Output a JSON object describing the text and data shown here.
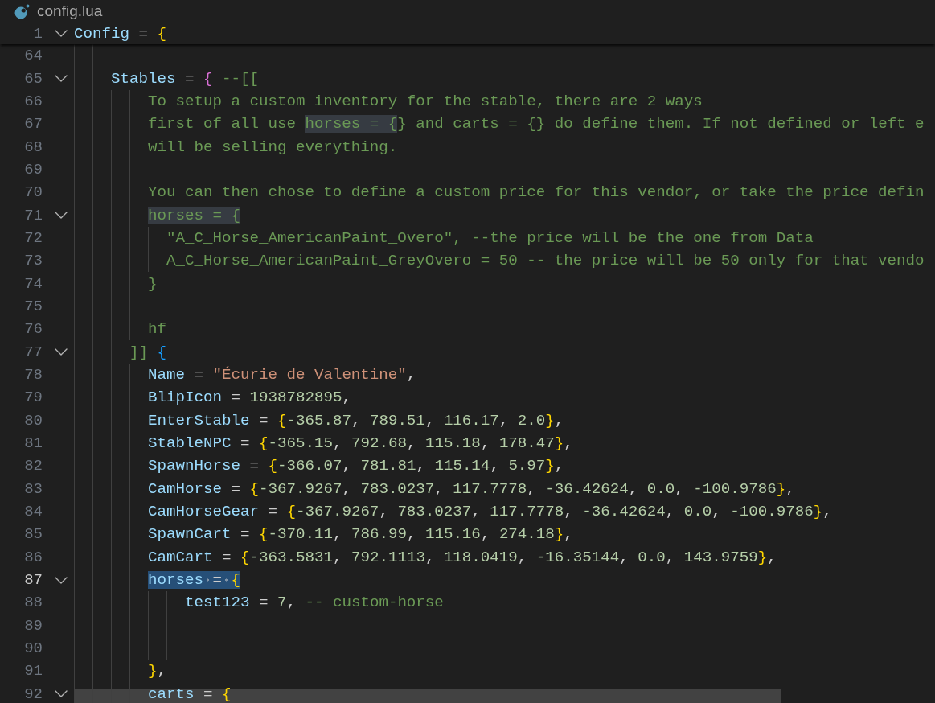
{
  "breadcrumb": {
    "file": "config.lua"
  },
  "sticky_scroll": [
    {
      "number": "1",
      "fold": {
        "expanded": true
      },
      "current": false,
      "tokens": [
        {
          "kind": "variable",
          "text": "Config"
        },
        {
          "kind": "plain",
          "text": " = "
        },
        {
          "kind": "bracket",
          "text": "{",
          "color": "#ffd700"
        }
      ]
    }
  ],
  "lines": [
    {
      "number": "64",
      "current": false
    },
    {
      "number": "65",
      "fold": {
        "expanded": true
      },
      "current": false,
      "tokens": [
        {
          "kind": "variable",
          "text": "    Stables"
        },
        {
          "kind": "plain",
          "text": " = "
        },
        {
          "kind": "bracket",
          "text": "{",
          "color": "#da70d6"
        },
        {
          "kind": "comment",
          "text": " --[["
        }
      ]
    },
    {
      "number": "66",
      "current": false,
      "tokens": [
        {
          "kind": "comment",
          "text": "        To setup a custom inventory for the stable, there are 2 ways"
        }
      ]
    },
    {
      "number": "67",
      "current": false,
      "tokens": [
        {
          "kind": "comment",
          "text": "        first of all use "
        },
        {
          "kind": "comment",
          "text": "horses = {",
          "highlighted": true
        },
        {
          "kind": "comment",
          "text": "} and carts = {} do define them. If not defined or left e"
        }
      ]
    },
    {
      "number": "68",
      "current": false,
      "tokens": [
        {
          "kind": "comment",
          "text": "        will be selling everything."
        }
      ]
    },
    {
      "number": "69",
      "current": false
    },
    {
      "number": "70",
      "current": false,
      "tokens": [
        {
          "kind": "comment",
          "text": "        You can then chose to define a custom price for this vendor, or take the price defin"
        }
      ]
    },
    {
      "number": "71",
      "fold": {
        "expanded": true
      },
      "current": false,
      "tokens": [
        {
          "kind": "comment",
          "text": "        horses = {",
          "highlighted": true
        }
      ]
    },
    {
      "number": "72",
      "current": false,
      "tokens": [
        {
          "kind": "comment",
          "text": "          \"A_C_Horse_AmericanPaint_Overo\", --the price will be the one from Data"
        }
      ]
    },
    {
      "number": "73",
      "current": false,
      "tokens": [
        {
          "kind": "comment",
          "text": "          A_C_Horse_AmericanPaint_GreyOvero = 50 -- the price will be 50 only for that vendo"
        }
      ]
    },
    {
      "number": "74",
      "current": false,
      "tokens": [
        {
          "kind": "comment",
          "text": "        }"
        }
      ]
    },
    {
      "number": "75",
      "current": false
    },
    {
      "number": "76",
      "current": false,
      "tokens": [
        {
          "kind": "comment",
          "text": "        hf"
        }
      ]
    },
    {
      "number": "77",
      "fold": {
        "expanded": true
      },
      "current": false,
      "tokens": [
        {
          "kind": "comment",
          "text": "      ]] "
        },
        {
          "kind": "bracket",
          "text": "{",
          "color": "#179fff"
        }
      ]
    },
    {
      "number": "78",
      "current": false,
      "tokens": [
        {
          "kind": "variable",
          "text": "        Name"
        },
        {
          "kind": "plain",
          "text": " = "
        },
        {
          "kind": "string",
          "text": "\"Écurie de Valentine\""
        },
        {
          "kind": "plain",
          "text": ","
        }
      ]
    },
    {
      "number": "79",
      "current": false,
      "tokens": [
        {
          "kind": "variable",
          "text": "        BlipIcon"
        },
        {
          "kind": "plain",
          "text": " = "
        },
        {
          "kind": "number",
          "text": "1938782895"
        },
        {
          "kind": "plain",
          "text": ","
        }
      ]
    },
    {
      "number": "80",
      "current": false,
      "tokens": [
        {
          "kind": "variable",
          "text": "        EnterStable"
        },
        {
          "kind": "plain",
          "text": " = "
        },
        {
          "kind": "bracket",
          "text": "{",
          "color": "#ffd700"
        },
        {
          "kind": "number",
          "text": "-365.87"
        },
        {
          "kind": "plain",
          "text": ", "
        },
        {
          "kind": "number",
          "text": "789.51"
        },
        {
          "kind": "plain",
          "text": ", "
        },
        {
          "kind": "number",
          "text": "116.17"
        },
        {
          "kind": "plain",
          "text": ", "
        },
        {
          "kind": "number",
          "text": "2.0"
        },
        {
          "kind": "bracket",
          "text": "}",
          "color": "#ffd700"
        },
        {
          "kind": "plain",
          "text": ","
        }
      ]
    },
    {
      "number": "81",
      "current": false,
      "tokens": [
        {
          "kind": "variable",
          "text": "        StableNPC"
        },
        {
          "kind": "plain",
          "text": " = "
        },
        {
          "kind": "bracket",
          "text": "{",
          "color": "#ffd700"
        },
        {
          "kind": "number",
          "text": "-365.15"
        },
        {
          "kind": "plain",
          "text": ", "
        },
        {
          "kind": "number",
          "text": "792.68"
        },
        {
          "kind": "plain",
          "text": ", "
        },
        {
          "kind": "number",
          "text": "115.18"
        },
        {
          "kind": "plain",
          "text": ", "
        },
        {
          "kind": "number",
          "text": "178.47"
        },
        {
          "kind": "bracket",
          "text": "}",
          "color": "#ffd700"
        },
        {
          "kind": "plain",
          "text": ","
        }
      ]
    },
    {
      "number": "82",
      "current": false,
      "tokens": [
        {
          "kind": "variable",
          "text": "        SpawnHorse"
        },
        {
          "kind": "plain",
          "text": " = "
        },
        {
          "kind": "bracket",
          "text": "{",
          "color": "#ffd700"
        },
        {
          "kind": "number",
          "text": "-366.07"
        },
        {
          "kind": "plain",
          "text": ", "
        },
        {
          "kind": "number",
          "text": "781.81"
        },
        {
          "kind": "plain",
          "text": ", "
        },
        {
          "kind": "number",
          "text": "115.14"
        },
        {
          "kind": "plain",
          "text": ", "
        },
        {
          "kind": "number",
          "text": "5.97"
        },
        {
          "kind": "bracket",
          "text": "}",
          "color": "#ffd700"
        },
        {
          "kind": "plain",
          "text": ","
        }
      ]
    },
    {
      "number": "83",
      "current": false,
      "tokens": [
        {
          "kind": "variable",
          "text": "        CamHorse"
        },
        {
          "kind": "plain",
          "text": " = "
        },
        {
          "kind": "bracket",
          "text": "{",
          "color": "#ffd700"
        },
        {
          "kind": "number",
          "text": "-367.9267"
        },
        {
          "kind": "plain",
          "text": ", "
        },
        {
          "kind": "number",
          "text": "783.0237"
        },
        {
          "kind": "plain",
          "text": ", "
        },
        {
          "kind": "number",
          "text": "117.7778"
        },
        {
          "kind": "plain",
          "text": ", "
        },
        {
          "kind": "number",
          "text": "-36.42624"
        },
        {
          "kind": "plain",
          "text": ", "
        },
        {
          "kind": "number",
          "text": "0.0"
        },
        {
          "kind": "plain",
          "text": ", "
        },
        {
          "kind": "number",
          "text": "-100.9786"
        },
        {
          "kind": "bracket",
          "text": "}",
          "color": "#ffd700"
        },
        {
          "kind": "plain",
          "text": ","
        }
      ]
    },
    {
      "number": "84",
      "current": false,
      "tokens": [
        {
          "kind": "variable",
          "text": "        CamHorseGear"
        },
        {
          "kind": "plain",
          "text": " = "
        },
        {
          "kind": "bracket",
          "text": "{",
          "color": "#ffd700"
        },
        {
          "kind": "number",
          "text": "-367.9267"
        },
        {
          "kind": "plain",
          "text": ", "
        },
        {
          "kind": "number",
          "text": "783.0237"
        },
        {
          "kind": "plain",
          "text": ", "
        },
        {
          "kind": "number",
          "text": "117.7778"
        },
        {
          "kind": "plain",
          "text": ", "
        },
        {
          "kind": "number",
          "text": "-36.42624"
        },
        {
          "kind": "plain",
          "text": ", "
        },
        {
          "kind": "number",
          "text": "0.0"
        },
        {
          "kind": "plain",
          "text": ", "
        },
        {
          "kind": "number",
          "text": "-100.9786"
        },
        {
          "kind": "bracket",
          "text": "}",
          "color": "#ffd700"
        },
        {
          "kind": "plain",
          "text": ","
        }
      ]
    },
    {
      "number": "85",
      "current": false,
      "tokens": [
        {
          "kind": "variable",
          "text": "        SpawnCart"
        },
        {
          "kind": "plain",
          "text": " = "
        },
        {
          "kind": "bracket",
          "text": "{",
          "color": "#ffd700"
        },
        {
          "kind": "number",
          "text": "-370.11"
        },
        {
          "kind": "plain",
          "text": ", "
        },
        {
          "kind": "number",
          "text": "786.99"
        },
        {
          "kind": "plain",
          "text": ", "
        },
        {
          "kind": "number",
          "text": "115.16"
        },
        {
          "kind": "plain",
          "text": ", "
        },
        {
          "kind": "number",
          "text": "274.18"
        },
        {
          "kind": "bracket",
          "text": "}",
          "color": "#ffd700"
        },
        {
          "kind": "plain",
          "text": ","
        }
      ]
    },
    {
      "number": "86",
      "current": false,
      "tokens": [
        {
          "kind": "variable",
          "text": "        CamCart"
        },
        {
          "kind": "plain",
          "text": " = "
        },
        {
          "kind": "bracket",
          "text": "{",
          "color": "#ffd700"
        },
        {
          "kind": "number",
          "text": "-363.5831"
        },
        {
          "kind": "plain",
          "text": ", "
        },
        {
          "kind": "number",
          "text": "792.1113"
        },
        {
          "kind": "plain",
          "text": ", "
        },
        {
          "kind": "number",
          "text": "118.0419"
        },
        {
          "kind": "plain",
          "text": ", "
        },
        {
          "kind": "number",
          "text": "-16.35144"
        },
        {
          "kind": "plain",
          "text": ", "
        },
        {
          "kind": "number",
          "text": "0.0"
        },
        {
          "kind": "plain",
          "text": ", "
        },
        {
          "kind": "number",
          "text": "143.9759"
        },
        {
          "kind": "bracket",
          "text": "}",
          "color": "#ffd700"
        },
        {
          "kind": "plain",
          "text": ","
        }
      ]
    },
    {
      "number": "87",
      "fold": {
        "expanded": true
      },
      "current": true,
      "tokens": [
        {
          "kind": "variable",
          "text": "        horses",
          "selected": true
        },
        {
          "kind": "plain",
          "text": " = ",
          "selected": true
        },
        {
          "kind": "bracket",
          "text": "{",
          "selected": true
        }
      ]
    },
    {
      "number": "88",
      "current": false,
      "tokens": [
        {
          "kind": "variable",
          "text": "            test123"
        },
        {
          "kind": "plain",
          "text": " = "
        },
        {
          "kind": "number",
          "text": "7"
        },
        {
          "kind": "plain",
          "text": ", "
        },
        {
          "kind": "comment",
          "text": "-- custom-horse"
        }
      ]
    },
    {
      "number": "89",
      "current": false
    },
    {
      "number": "90",
      "current": false
    },
    {
      "number": "91",
      "current": false,
      "tokens": [
        {
          "kind": "bracket",
          "text": "        }",
          "color": "#ffd700"
        },
        {
          "kind": "plain",
          "text": ","
        }
      ]
    },
    {
      "number": "92",
      "fold": {
        "expanded": true
      },
      "current": false,
      "tokens": [
        {
          "kind": "variable",
          "text": "        carts"
        },
        {
          "kind": "plain",
          "text": " = "
        },
        {
          "kind": "bracket",
          "text": "{",
          "color": "#ffd700"
        }
      ]
    }
  ]
}
